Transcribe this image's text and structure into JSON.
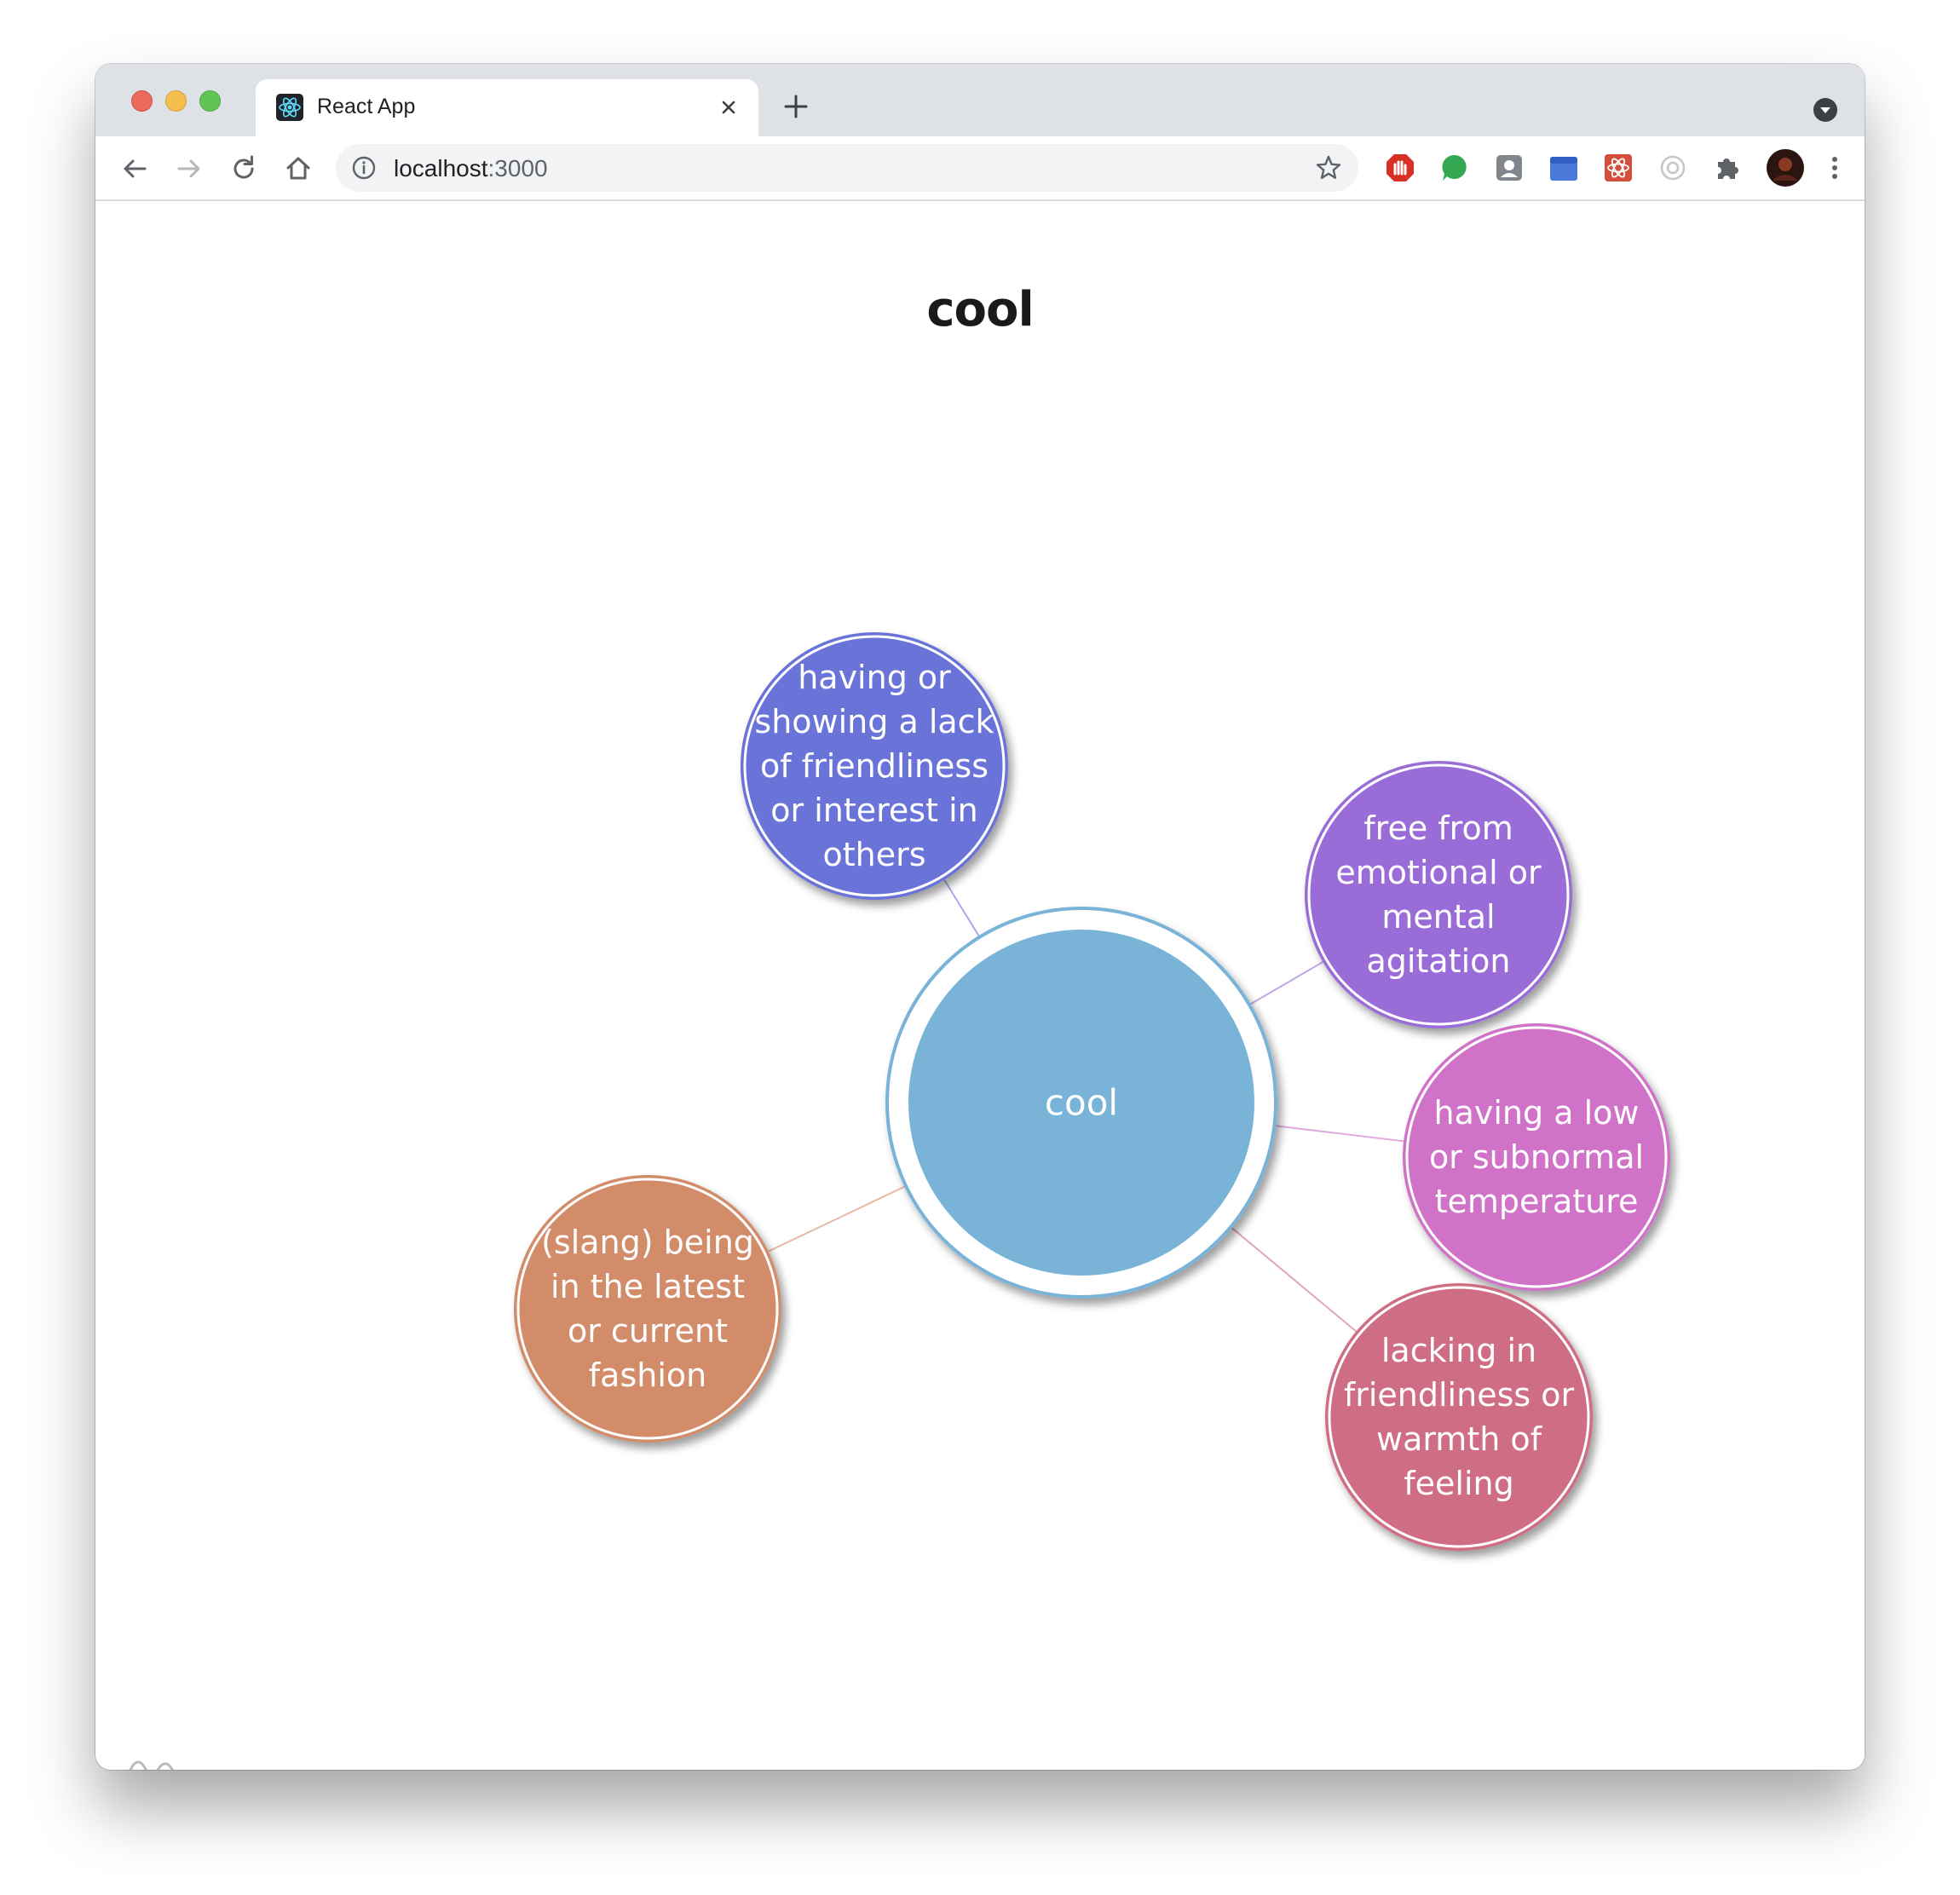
{
  "browser": {
    "tab_title": "React App",
    "url_host": "localhost",
    "url_port": ":3000"
  },
  "page": {
    "title": "cool"
  },
  "graph": {
    "center": {
      "label": "cool",
      "color": "#79b4d8"
    },
    "nodes": [
      {
        "lines": [
          "having or",
          "showing a lack",
          "of friendliness",
          "or interest in",
          "others"
        ],
        "color": "#6a73d8"
      },
      {
        "lines": [
          "free from",
          "emotional or",
          "mental",
          "agitation"
        ],
        "color": "#9a6cd8"
      },
      {
        "lines": [
          "having a low",
          "or subnormal",
          "temperature"
        ],
        "color": "#cf72c8"
      },
      {
        "lines": [
          "lacking in",
          "friendliness or",
          "warmth of",
          "feeling"
        ],
        "color": "#cf6d84"
      },
      {
        "lines": [
          "(slang) being",
          "in the latest",
          "or current",
          "fashion"
        ],
        "color": "#d38c6b"
      }
    ]
  }
}
